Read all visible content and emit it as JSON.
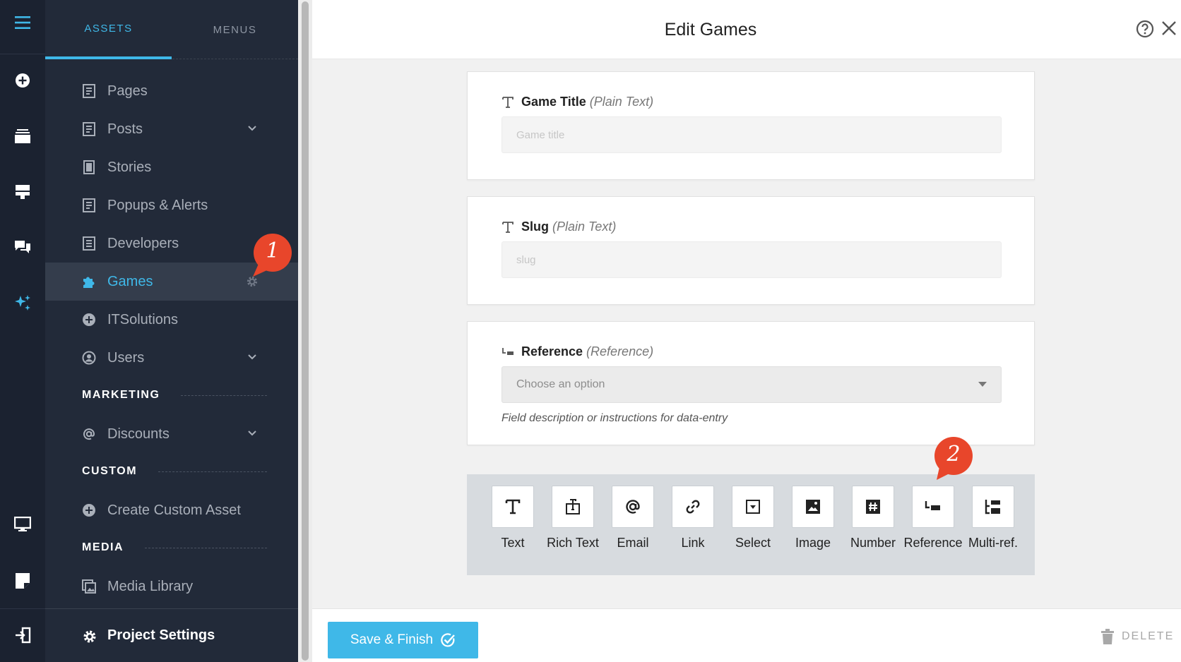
{
  "sidebar": {
    "tabs": [
      {
        "label": "ASSETS"
      },
      {
        "label": "MENUS"
      }
    ],
    "items": {
      "pages": "Pages",
      "posts": "Posts",
      "stories": "Stories",
      "popups": "Popups & Alerts",
      "developers": "Developers",
      "games": "Games",
      "itsolutions": "ITSolutions",
      "users": "Users",
      "discounts": "Discounts",
      "create_custom": "Create Custom Asset",
      "media_library": "Media Library"
    },
    "sections": {
      "marketing": "MARKETING",
      "custom": "CUSTOM",
      "media": "MEDIA"
    },
    "project_settings": "Project Settings"
  },
  "header": {
    "title": "Edit Games"
  },
  "fields": {
    "game_title": {
      "label": "Game Title",
      "type": "(Plain Text)",
      "placeholder": "Game title"
    },
    "slug": {
      "label": "Slug",
      "type": "(Plain Text)",
      "placeholder": "slug"
    },
    "reference": {
      "label": "Reference",
      "type": "(Reference)",
      "select_placeholder": "Choose an option",
      "description": "Field description or instructions for data-entry"
    }
  },
  "tools": [
    {
      "label": "Text"
    },
    {
      "label": "Rich Text"
    },
    {
      "label": "Email"
    },
    {
      "label": "Link"
    },
    {
      "label": "Select"
    },
    {
      "label": "Image"
    },
    {
      "label": "Number"
    },
    {
      "label": "Reference"
    },
    {
      "label": "Multi-ref."
    }
  ],
  "footer": {
    "save_label": "Save & Finish",
    "delete_label": "DELETE"
  },
  "badges": {
    "one": "1",
    "two": "2"
  },
  "colors": {
    "accent": "#3fb8e8",
    "sidebar_bg": "#222a39",
    "rail_bg": "#1b2230",
    "badge": "#e8462b"
  }
}
